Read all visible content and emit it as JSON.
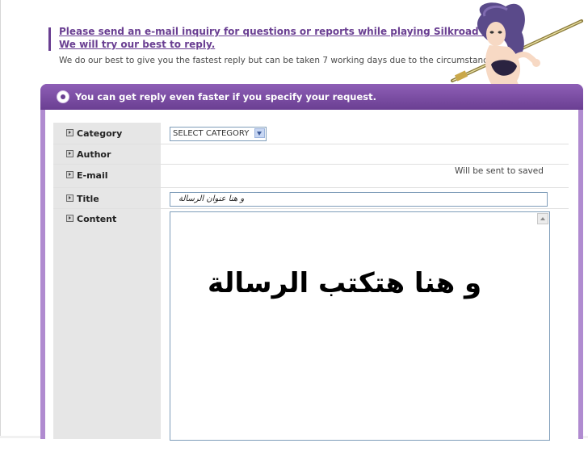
{
  "intro": {
    "link_line1": "Please send an e-mail inquiry for questions or reports while playing Silkroad Online.",
    "link_line2": "We will try our best to reply.",
    "note": "We do our best to give you the fastest reply but can be taken 7 working days due to the circumstance."
  },
  "panel": {
    "header": "You can get reply even faster if you specify your request."
  },
  "form": {
    "labels": {
      "category": "Category",
      "author": "Author",
      "email": "E-mail",
      "title": "Title",
      "content": "Content"
    },
    "category_selected": "SELECT CATEGORY",
    "email_note": "Will be sent to saved",
    "title_value": "و هنا عنوان الرسالة",
    "content_value": "و هنا هتكتب الرسالة"
  },
  "colors": {
    "accent": "#6a3f92",
    "panel": "#b08bd0",
    "label_column": "#e6e6e6"
  },
  "icons": {
    "header": "circle-arrow-icon",
    "label_bullet": "square-arrow-icon",
    "dropdown": "chevron-down-icon",
    "scroll": "scroll-up-icon"
  }
}
